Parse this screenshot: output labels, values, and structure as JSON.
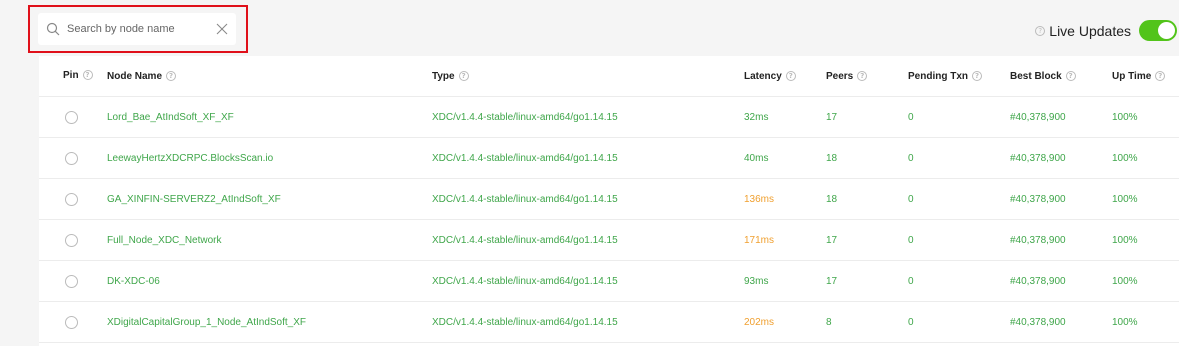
{
  "search": {
    "placeholder": "Search by node name",
    "value": ""
  },
  "live_updates": {
    "label": "Live Updates",
    "enabled": true
  },
  "columns": {
    "pin": "Pin",
    "name": "Node Name",
    "type": "Type",
    "latency": "Latency",
    "peers": "Peers",
    "pending": "Pending Txn",
    "block": "Best Block",
    "uptime": "Up Time"
  },
  "rows": [
    {
      "name": "Lord_Bae_AtIndSoft_XF_XF",
      "type": "XDC/v1.4.4-stable/linux-amd64/go1.14.15",
      "latency": "32ms",
      "latency_status": "good",
      "peers": "17",
      "pending": "0",
      "block": "#40,378,900",
      "uptime": "100%"
    },
    {
      "name": "LeewayHertzXDCRPC.BlocksScan.io",
      "type": "XDC/v1.4.4-stable/linux-amd64/go1.14.15",
      "latency": "40ms",
      "latency_status": "good",
      "peers": "18",
      "pending": "0",
      "block": "#40,378,900",
      "uptime": "100%"
    },
    {
      "name": "GA_XINFIN-SERVERZ2_AtIndSoft_XF",
      "type": "XDC/v1.4.4-stable/linux-amd64/go1.14.15",
      "latency": "136ms",
      "latency_status": "warn",
      "peers": "18",
      "pending": "0",
      "block": "#40,378,900",
      "uptime": "100%"
    },
    {
      "name": "Full_Node_XDC_Network",
      "type": "XDC/v1.4.4-stable/linux-amd64/go1.14.15",
      "latency": "171ms",
      "latency_status": "warn",
      "peers": "17",
      "pending": "0",
      "block": "#40,378,900",
      "uptime": "100%"
    },
    {
      "name": "DK-XDC-06",
      "type": "XDC/v1.4.4-stable/linux-amd64/go1.14.15",
      "latency": "93ms",
      "latency_status": "good",
      "peers": "17",
      "pending": "0",
      "block": "#40,378,900",
      "uptime": "100%"
    },
    {
      "name": "XDigitalCapitalGroup_1_Node_AtIndSoft_XF",
      "type": "XDC/v1.4.4-stable/linux-amd64/go1.14.15",
      "latency": "202ms",
      "latency_status": "warn",
      "peers": "8",
      "pending": "0",
      "block": "#40,378,900",
      "uptime": "100%"
    }
  ],
  "colors": {
    "accent_green": "#3fa64a",
    "warn_orange": "#f0a030",
    "toggle_on": "#52c41a",
    "highlight_red": "#e0101a"
  }
}
